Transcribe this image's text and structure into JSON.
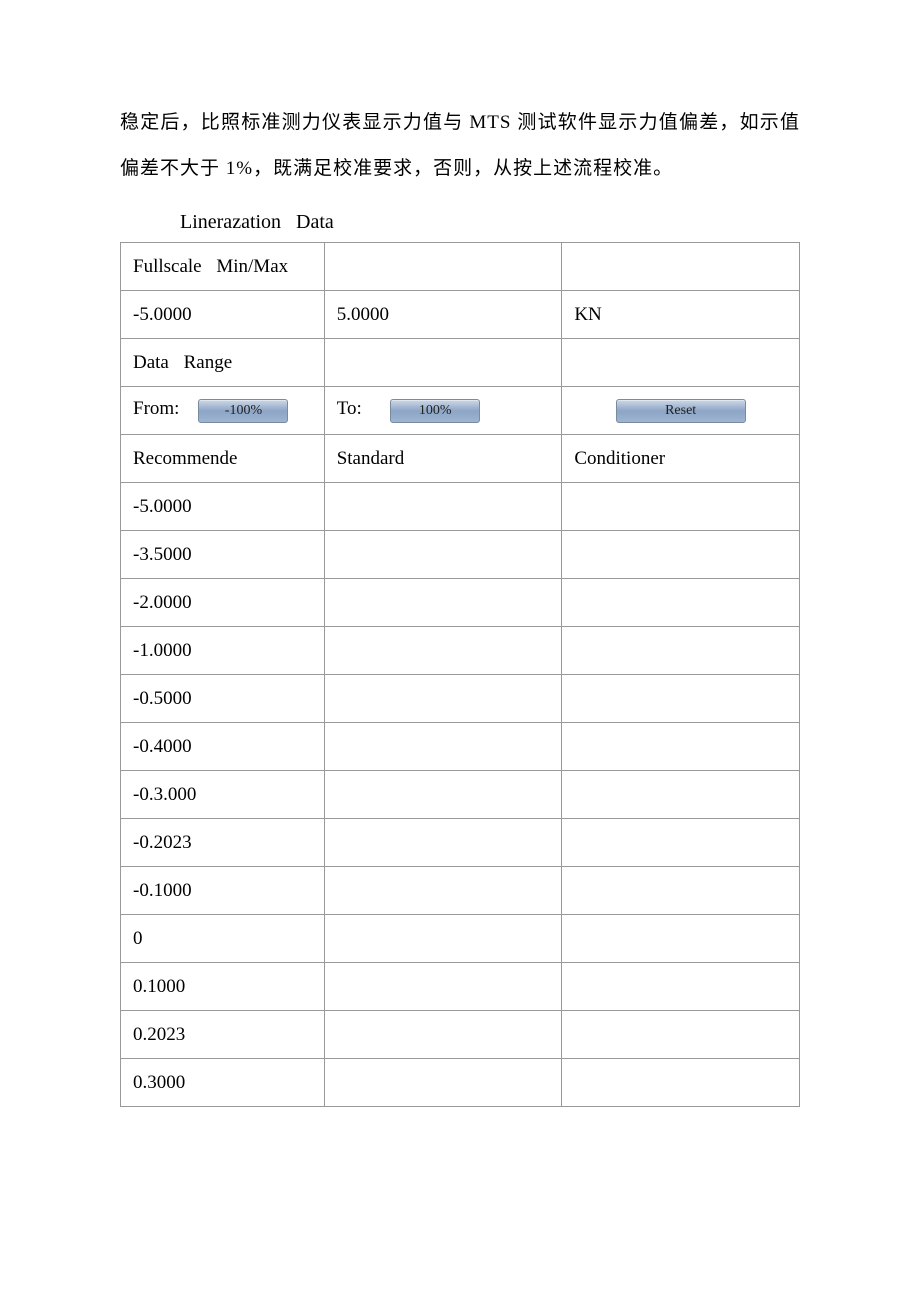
{
  "paragraph": "稳定后，比照标准测力仪表显示力值与 MTS 测试软件显示力值偏差，如示值偏差不大于 1%，既满足校准要求，否则，从按上述流程校准。",
  "sectionTitle": "Linerazation  Data",
  "row_fullscale_label": "Fullscale  Min/Max",
  "row_fullscale_min": "-5.0000",
  "row_fullscale_max": "5.0000",
  "row_fullscale_unit": "KN",
  "row_datarange_label": "Data  Range",
  "from_label": "From:",
  "from_btn": "-100%",
  "to_label": "To:",
  "to_btn": "100%",
  "reset_btn": "Reset",
  "headers": {
    "c1": "Recommende",
    "c2": "Standard",
    "c3": "Conditioner"
  },
  "rows": [
    "-5.0000",
    "-3.5000",
    "-2.0000",
    "-1.0000",
    "-0.5000",
    "-0.4000",
    "-0.3.000",
    "-0.2023",
    "-0.1000",
    "0",
    "0.1000",
    "0.2023",
    "0.3000"
  ]
}
